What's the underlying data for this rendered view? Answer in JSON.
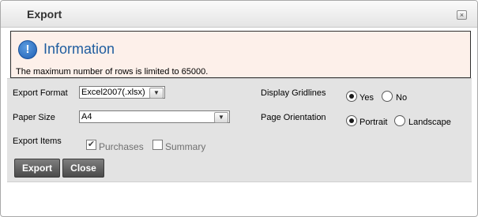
{
  "dialog": {
    "title": "Export",
    "close_symbol": "×",
    "close_icon": "close-icon"
  },
  "info": {
    "icon": "info-icon",
    "icon_glyph": "!",
    "title": "Information",
    "message": "The maximum number of rows is limited to 65000."
  },
  "form": {
    "export_format_label": "Export Format",
    "export_format_value": "Excel2007(.xlsx)",
    "paper_size_label": "Paper Size",
    "paper_size_value": "A4",
    "export_items_label": "Export Items",
    "purchases_label": "Purchases",
    "purchases_checked": true,
    "summary_label": "Summary",
    "summary_checked": false,
    "display_gridlines_label": "Display Gridlines",
    "gridlines_yes_label": "Yes",
    "gridlines_no_label": "No",
    "gridlines_selected": "Yes",
    "page_orientation_label": "Page Orientation",
    "orientation_portrait_label": "Portrait",
    "orientation_landscape_label": "Landscape",
    "orientation_selected": "Portrait",
    "dropdown_arrow": "▼",
    "check_mark": "✔"
  },
  "buttons": {
    "export_label": "Export",
    "close_label": "Close"
  },
  "colors": {
    "info_background": "#fdf0ea",
    "info_title": "#1f5d9f",
    "button": "#5a5a5a"
  }
}
